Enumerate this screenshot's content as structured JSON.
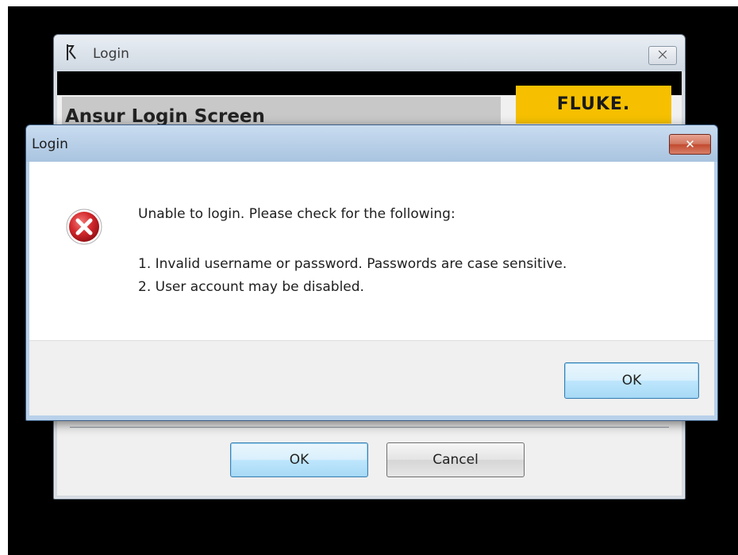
{
  "back_window": {
    "title": "Login",
    "close_glyph": "⨉",
    "heading": "Ansur Login Screen",
    "logo_text": "FLUKE.",
    "ok_label": "OK",
    "cancel_label": "Cancel",
    "logo_color": "#f6c000"
  },
  "dialog": {
    "title": "Login",
    "close_glyph": "✕",
    "icon": "error-icon",
    "message": "Unable to login. Please check for the following:",
    "lines": [
      "1. Invalid username or password. Passwords are case sensitive.",
      "2. User account may be disabled."
    ],
    "ok_label": "OK",
    "close_color": "#c24a2e",
    "error_color": "#c8202a"
  }
}
